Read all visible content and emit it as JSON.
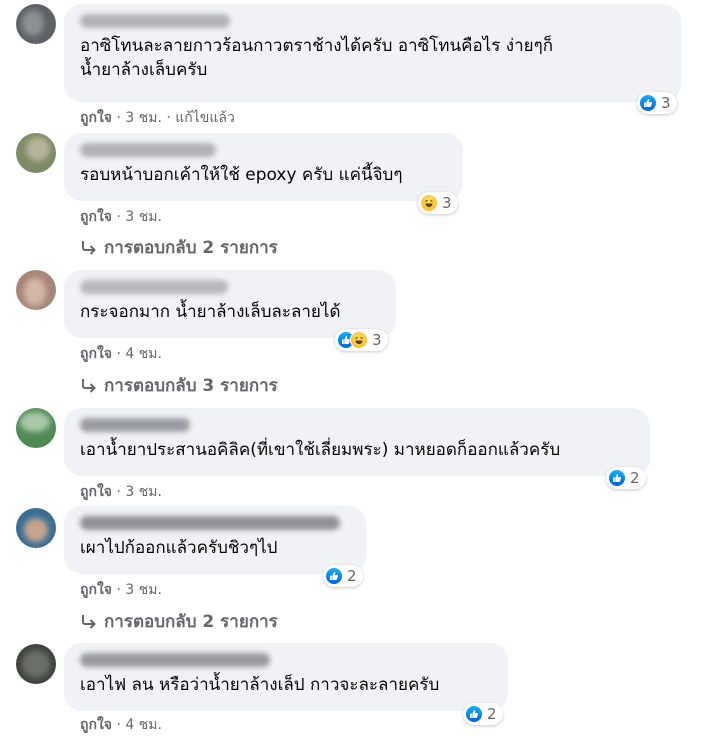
{
  "comments": [
    {
      "text": "อาซิโทนละลายกาวร้อนกาวตราช้างได้ครับ อาซิโทนคือไร ง่ายๆก็\nน้ำยาล้างเล็บครับ",
      "meta": {
        "like": "ถูกใจ",
        "dot": "·",
        "time": "3 ชม.",
        "dot2": "·",
        "edited": "แก้ไขแล้ว"
      },
      "reaction": {
        "icons": [
          "like-icon"
        ],
        "count": "3"
      },
      "avatar_color": "#6b6f73",
      "author_color": "#9a9da3"
    },
    {
      "text": "รอบหน้าบอกเค้าให้ใช้ epoxy ครับ แค่นี้จิบๆ",
      "meta": {
        "like": "ถูกใจ",
        "dot": "·",
        "time": "3 ชม."
      },
      "reaction": {
        "icons": [
          "haha-icon"
        ],
        "count": "3"
      },
      "replies": "การตอบกลับ 2 รายการ",
      "avatar_color": "#8a8f6c",
      "author_color": "#9a9da3"
    },
    {
      "text": "กระจอกมาก น้ำยาล้างเล็บละลายได้",
      "meta": {
        "like": "ถูกใจ",
        "dot": "·",
        "time": "4 ชม."
      },
      "reaction": {
        "icons": [
          "like-icon",
          "haha-icon"
        ],
        "count": "3"
      },
      "replies": "การตอบกลับ 3 รายการ",
      "avatar_color": "#9c7b6b",
      "author_color": "#a3a5aa"
    },
    {
      "text": "เอาน้ำยาประสานอคิลิค(ที่เขาใช้เลี่ยมพระ) มาหยอดก็ออกแล้วครับ",
      "meta": {
        "like": "ถูกใจ",
        "dot": "·",
        "time": "3 ชม."
      },
      "reaction": {
        "icons": [
          "like-icon"
        ],
        "count": "2"
      },
      "avatar_color": "#4f8a55",
      "author_color": "#7d8088"
    },
    {
      "text": "เผาไปก้ออกแล้วครับชิวๆไป",
      "meta": {
        "like": "ถูกใจ",
        "dot": "·",
        "time": "3 ชม."
      },
      "reaction": {
        "icons": [
          "like-icon"
        ],
        "count": "2"
      },
      "replies": "การตอบกลับ 2 รายการ",
      "avatar_color": "#3b6f95",
      "author_color": "#6e7178"
    },
    {
      "text": "เอาไฟ ลน หรือว่าน้ำยาล้างเล็ป กาวจะละลายครับ",
      "meta": {
        "like": "ถูกใจ",
        "dot": "·",
        "time": "4 ชม."
      },
      "reaction": {
        "icons": [
          "like-icon"
        ],
        "count": "2"
      },
      "avatar_color": "#4a4d4a",
      "author_color": "#7a7c80"
    }
  ],
  "colors": {
    "bubble": "#f0f2f5",
    "meta_text": "#65676b",
    "like_blue": "#1877f2"
  }
}
